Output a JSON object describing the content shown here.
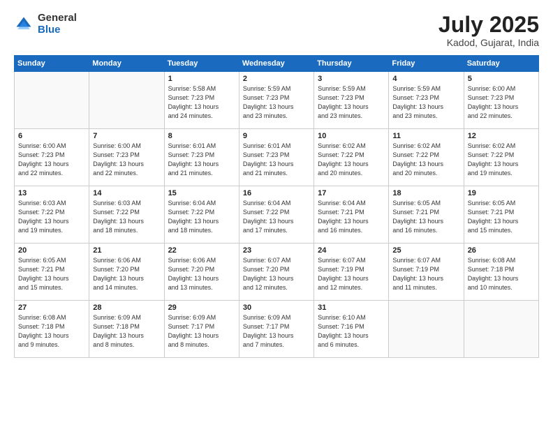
{
  "logo": {
    "general": "General",
    "blue": "Blue"
  },
  "header": {
    "month": "July 2025",
    "location": "Kadod, Gujarat, India"
  },
  "weekdays": [
    "Sunday",
    "Monday",
    "Tuesday",
    "Wednesday",
    "Thursday",
    "Friday",
    "Saturday"
  ],
  "weeks": [
    [
      {
        "day": "",
        "info": ""
      },
      {
        "day": "",
        "info": ""
      },
      {
        "day": "1",
        "info": "Sunrise: 5:58 AM\nSunset: 7:23 PM\nDaylight: 13 hours\nand 24 minutes."
      },
      {
        "day": "2",
        "info": "Sunrise: 5:59 AM\nSunset: 7:23 PM\nDaylight: 13 hours\nand 23 minutes."
      },
      {
        "day": "3",
        "info": "Sunrise: 5:59 AM\nSunset: 7:23 PM\nDaylight: 13 hours\nand 23 minutes."
      },
      {
        "day": "4",
        "info": "Sunrise: 5:59 AM\nSunset: 7:23 PM\nDaylight: 13 hours\nand 23 minutes."
      },
      {
        "day": "5",
        "info": "Sunrise: 6:00 AM\nSunset: 7:23 PM\nDaylight: 13 hours\nand 22 minutes."
      }
    ],
    [
      {
        "day": "6",
        "info": "Sunrise: 6:00 AM\nSunset: 7:23 PM\nDaylight: 13 hours\nand 22 minutes."
      },
      {
        "day": "7",
        "info": "Sunrise: 6:00 AM\nSunset: 7:23 PM\nDaylight: 13 hours\nand 22 minutes."
      },
      {
        "day": "8",
        "info": "Sunrise: 6:01 AM\nSunset: 7:23 PM\nDaylight: 13 hours\nand 21 minutes."
      },
      {
        "day": "9",
        "info": "Sunrise: 6:01 AM\nSunset: 7:23 PM\nDaylight: 13 hours\nand 21 minutes."
      },
      {
        "day": "10",
        "info": "Sunrise: 6:02 AM\nSunset: 7:22 PM\nDaylight: 13 hours\nand 20 minutes."
      },
      {
        "day": "11",
        "info": "Sunrise: 6:02 AM\nSunset: 7:22 PM\nDaylight: 13 hours\nand 20 minutes."
      },
      {
        "day": "12",
        "info": "Sunrise: 6:02 AM\nSunset: 7:22 PM\nDaylight: 13 hours\nand 19 minutes."
      }
    ],
    [
      {
        "day": "13",
        "info": "Sunrise: 6:03 AM\nSunset: 7:22 PM\nDaylight: 13 hours\nand 19 minutes."
      },
      {
        "day": "14",
        "info": "Sunrise: 6:03 AM\nSunset: 7:22 PM\nDaylight: 13 hours\nand 18 minutes."
      },
      {
        "day": "15",
        "info": "Sunrise: 6:04 AM\nSunset: 7:22 PM\nDaylight: 13 hours\nand 18 minutes."
      },
      {
        "day": "16",
        "info": "Sunrise: 6:04 AM\nSunset: 7:22 PM\nDaylight: 13 hours\nand 17 minutes."
      },
      {
        "day": "17",
        "info": "Sunrise: 6:04 AM\nSunset: 7:21 PM\nDaylight: 13 hours\nand 16 minutes."
      },
      {
        "day": "18",
        "info": "Sunrise: 6:05 AM\nSunset: 7:21 PM\nDaylight: 13 hours\nand 16 minutes."
      },
      {
        "day": "19",
        "info": "Sunrise: 6:05 AM\nSunset: 7:21 PM\nDaylight: 13 hours\nand 15 minutes."
      }
    ],
    [
      {
        "day": "20",
        "info": "Sunrise: 6:05 AM\nSunset: 7:21 PM\nDaylight: 13 hours\nand 15 minutes."
      },
      {
        "day": "21",
        "info": "Sunrise: 6:06 AM\nSunset: 7:20 PM\nDaylight: 13 hours\nand 14 minutes."
      },
      {
        "day": "22",
        "info": "Sunrise: 6:06 AM\nSunset: 7:20 PM\nDaylight: 13 hours\nand 13 minutes."
      },
      {
        "day": "23",
        "info": "Sunrise: 6:07 AM\nSunset: 7:20 PM\nDaylight: 13 hours\nand 12 minutes."
      },
      {
        "day": "24",
        "info": "Sunrise: 6:07 AM\nSunset: 7:19 PM\nDaylight: 13 hours\nand 12 minutes."
      },
      {
        "day": "25",
        "info": "Sunrise: 6:07 AM\nSunset: 7:19 PM\nDaylight: 13 hours\nand 11 minutes."
      },
      {
        "day": "26",
        "info": "Sunrise: 6:08 AM\nSunset: 7:18 PM\nDaylight: 13 hours\nand 10 minutes."
      }
    ],
    [
      {
        "day": "27",
        "info": "Sunrise: 6:08 AM\nSunset: 7:18 PM\nDaylight: 13 hours\nand 9 minutes."
      },
      {
        "day": "28",
        "info": "Sunrise: 6:09 AM\nSunset: 7:18 PM\nDaylight: 13 hours\nand 8 minutes."
      },
      {
        "day": "29",
        "info": "Sunrise: 6:09 AM\nSunset: 7:17 PM\nDaylight: 13 hours\nand 8 minutes."
      },
      {
        "day": "30",
        "info": "Sunrise: 6:09 AM\nSunset: 7:17 PM\nDaylight: 13 hours\nand 7 minutes."
      },
      {
        "day": "31",
        "info": "Sunrise: 6:10 AM\nSunset: 7:16 PM\nDaylight: 13 hours\nand 6 minutes."
      },
      {
        "day": "",
        "info": ""
      },
      {
        "day": "",
        "info": ""
      }
    ]
  ]
}
